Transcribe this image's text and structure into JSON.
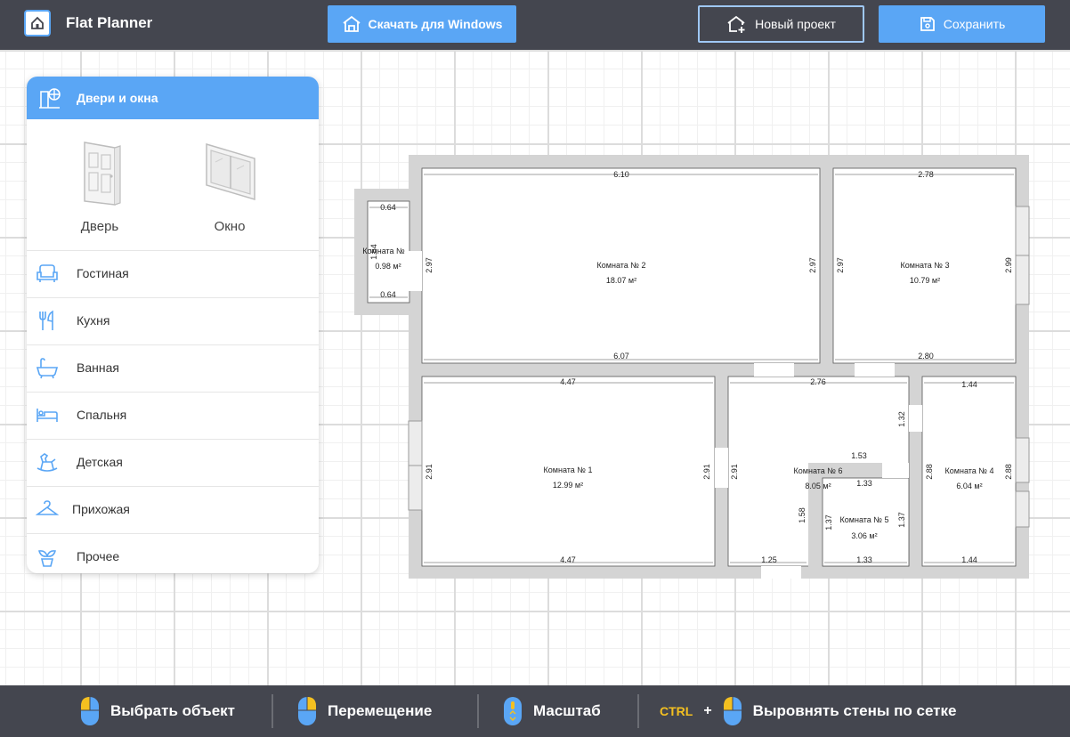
{
  "app": {
    "title": "Flat Planner"
  },
  "header": {
    "download_label": "Скачать для Windows",
    "new_project_label": "Новый проект",
    "save_label": "Сохранить"
  },
  "panel": {
    "title": "Двери и окна",
    "tiles": [
      {
        "label": "Дверь",
        "icon": "door-icon"
      },
      {
        "label": "Окно",
        "icon": "window-icon"
      }
    ],
    "categories": [
      {
        "label": "Гостиная",
        "icon": "armchair-icon"
      },
      {
        "label": "Кухня",
        "icon": "cutlery-icon"
      },
      {
        "label": "Ванная",
        "icon": "bathtub-icon"
      },
      {
        "label": "Спальня",
        "icon": "bed-icon"
      },
      {
        "label": "Детская",
        "icon": "rocking-horse-icon"
      },
      {
        "label": "Прихожая",
        "icon": "hanger-icon"
      },
      {
        "label": "Прочее",
        "icon": "plant-icon"
      }
    ]
  },
  "plan": {
    "rooms": [
      {
        "name": "Комната №  2",
        "area": "18.07 м²"
      },
      {
        "name": "Комната №  3",
        "area": "10.79 м²"
      },
      {
        "name": "Комната №  1",
        "area": "12.99 м²"
      },
      {
        "name": "Комната №  6",
        "area": "8.05 м²"
      },
      {
        "name": "Комната №  4",
        "area": "6.04 м²"
      },
      {
        "name": "Комната №  5",
        "area": "3.06 м²"
      },
      {
        "name": "Комната №",
        "area": "0.98 м²"
      }
    ],
    "dimensions": {
      "r2_top": "6.10",
      "r2_bottom": "6.07",
      "r2_left": "2.97",
      "r2_right": "2.97",
      "r3_top": "2.78",
      "r3_bottom": "2.80",
      "r3_left": "2.97",
      "r3_right": "2.99",
      "r1_top": "4.47",
      "r1_bottom": "4.47",
      "r1_left": "2.91",
      "r1_right": "2.91",
      "r6_top": "2.76",
      "r6_left": "2.91",
      "r6_right": "1.32",
      "r6_mid": "1.53",
      "r6_bottom": "1.25",
      "r6_inner": "1.58",
      "r4_top": "1.44",
      "r4_bottom": "1.44",
      "r4_left": "2.88",
      "r4_right": "2.88",
      "r5_top": "1.33",
      "r5_bottom": "1.33",
      "r5_left": "1.37",
      "r5_right": "1.37",
      "small_top": "0.64",
      "small_bottom": "0.64",
      "small_side": "1.54"
    }
  },
  "footer": {
    "select_label": "Выбрать объект",
    "move_label": "Перемещение",
    "zoom_label": "Масштаб",
    "ctrl_label": "CTRL",
    "plus_label": "+",
    "align_label": "Выровнять стены по сетке"
  },
  "colors": {
    "accent": "#5aa6f5",
    "bar": "#44464f",
    "wall": "#d4d4d4",
    "mouse_highlight": "#f4c020"
  }
}
